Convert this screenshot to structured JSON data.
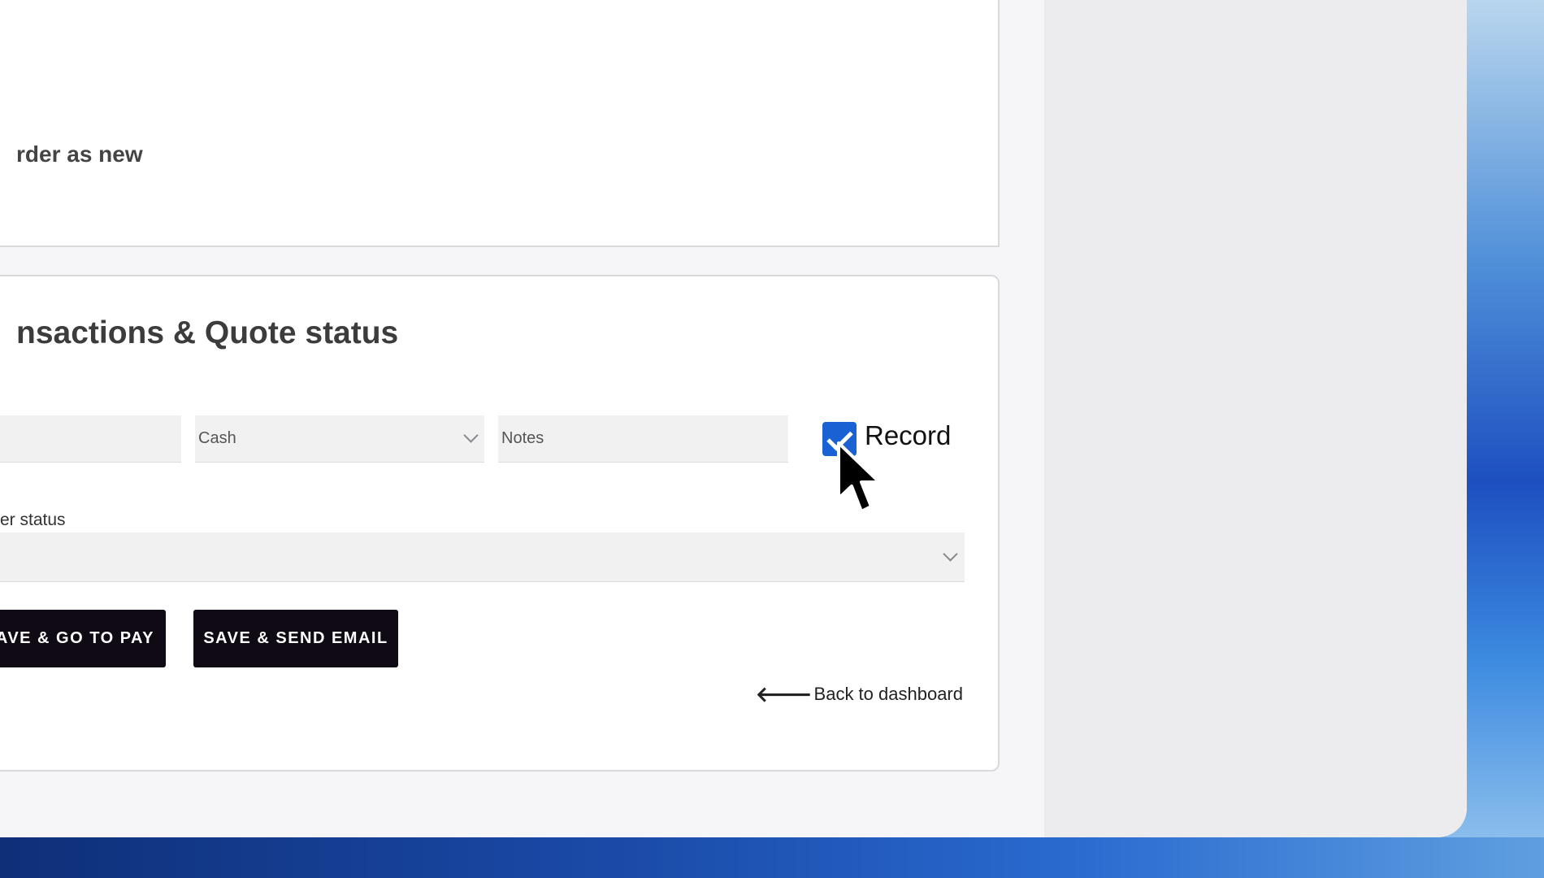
{
  "order": {
    "partial_text": "rder as new"
  },
  "section": {
    "title": "nsactions & Quote status"
  },
  "payment": {
    "amount_value": "",
    "method_value": "Cash",
    "notes_placeholder": "Notes",
    "record_label": "Record",
    "record_checked": true
  },
  "status": {
    "label": "er status",
    "value": ""
  },
  "buttons": {
    "save_go_pay": "AVE & GO TO PAY",
    "save_send_email": "SAVE & SEND EMAIL"
  },
  "navigation": {
    "back_arrow": "🡐",
    "back_label": "Back to dashboard"
  },
  "colors": {
    "checkbox": "#1a61d4",
    "button": "#0f0a13"
  }
}
